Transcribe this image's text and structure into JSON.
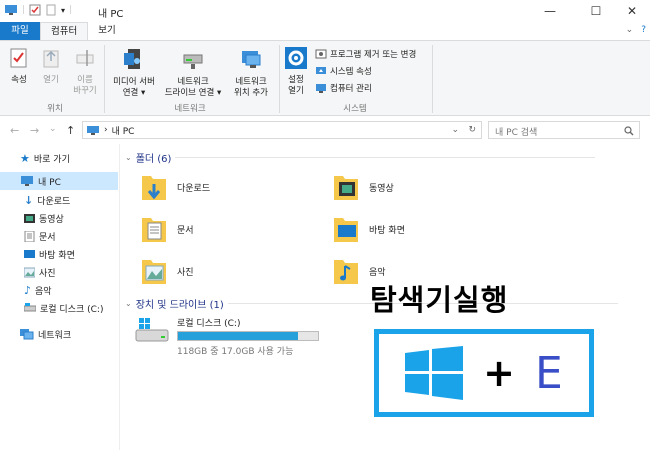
{
  "window": {
    "title": "내 PC",
    "minimize": "—",
    "maximize": "☐",
    "close": "✕"
  },
  "tabs": {
    "file": "파일",
    "computer": "컴퓨터",
    "view": "보기",
    "collapse": "⌄",
    "help": "?"
  },
  "ribbon": {
    "properties": "속성",
    "open": "열기",
    "rename_1": "이름",
    "rename_2": "바꾸기",
    "group_location": "위치",
    "media_1": "미디어 서버",
    "media_2": "연결",
    "netdrive_1": "네트워크",
    "netdrive_2": "드라이브 연결",
    "netloc_1": "네트워크",
    "netloc_2": "위치 추가",
    "group_network": "네트워크",
    "settings_1": "설정",
    "settings_2": "열기",
    "uninstall": "프로그램 제거 또는 변경",
    "system_props": "시스템 속성",
    "manage": "컴퓨터 관리",
    "group_system": "시스템"
  },
  "address": {
    "back": "←",
    "forward": "→",
    "recent": "⌄",
    "up": "↑",
    "chevron": "›",
    "path": "내 PC",
    "dropdown": "⌄",
    "refresh": "↻",
    "search_placeholder": "내 PC 검색"
  },
  "nav": {
    "quick": "바로 가기",
    "thispc": "내 PC",
    "downloads": "다운로드",
    "videos": "동영상",
    "documents": "문서",
    "desktop": "바탕 화면",
    "pictures": "사진",
    "music": "음악",
    "localdisk": "로컬 디스크 (C:)",
    "network": "네트워크"
  },
  "content": {
    "folders_header": "폴더 (6)",
    "folders": [
      "다운로드",
      "동영상",
      "문서",
      "바탕 화면",
      "사진",
      "음악"
    ],
    "drives_header": "장치 및 드라이브 (1)",
    "drive_name": "로컬 디스크 (C:)",
    "drive_info": "118GB 중 17.0GB 사용 가능",
    "drive_used_fraction": 0.856
  },
  "overlay": {
    "title": "탐색기실행",
    "plus": "+",
    "key": "E"
  },
  "colors": {
    "accent": "#1979ca",
    "windows_blue": "#1aa3e8",
    "key_blue": "#3a4fc7"
  }
}
